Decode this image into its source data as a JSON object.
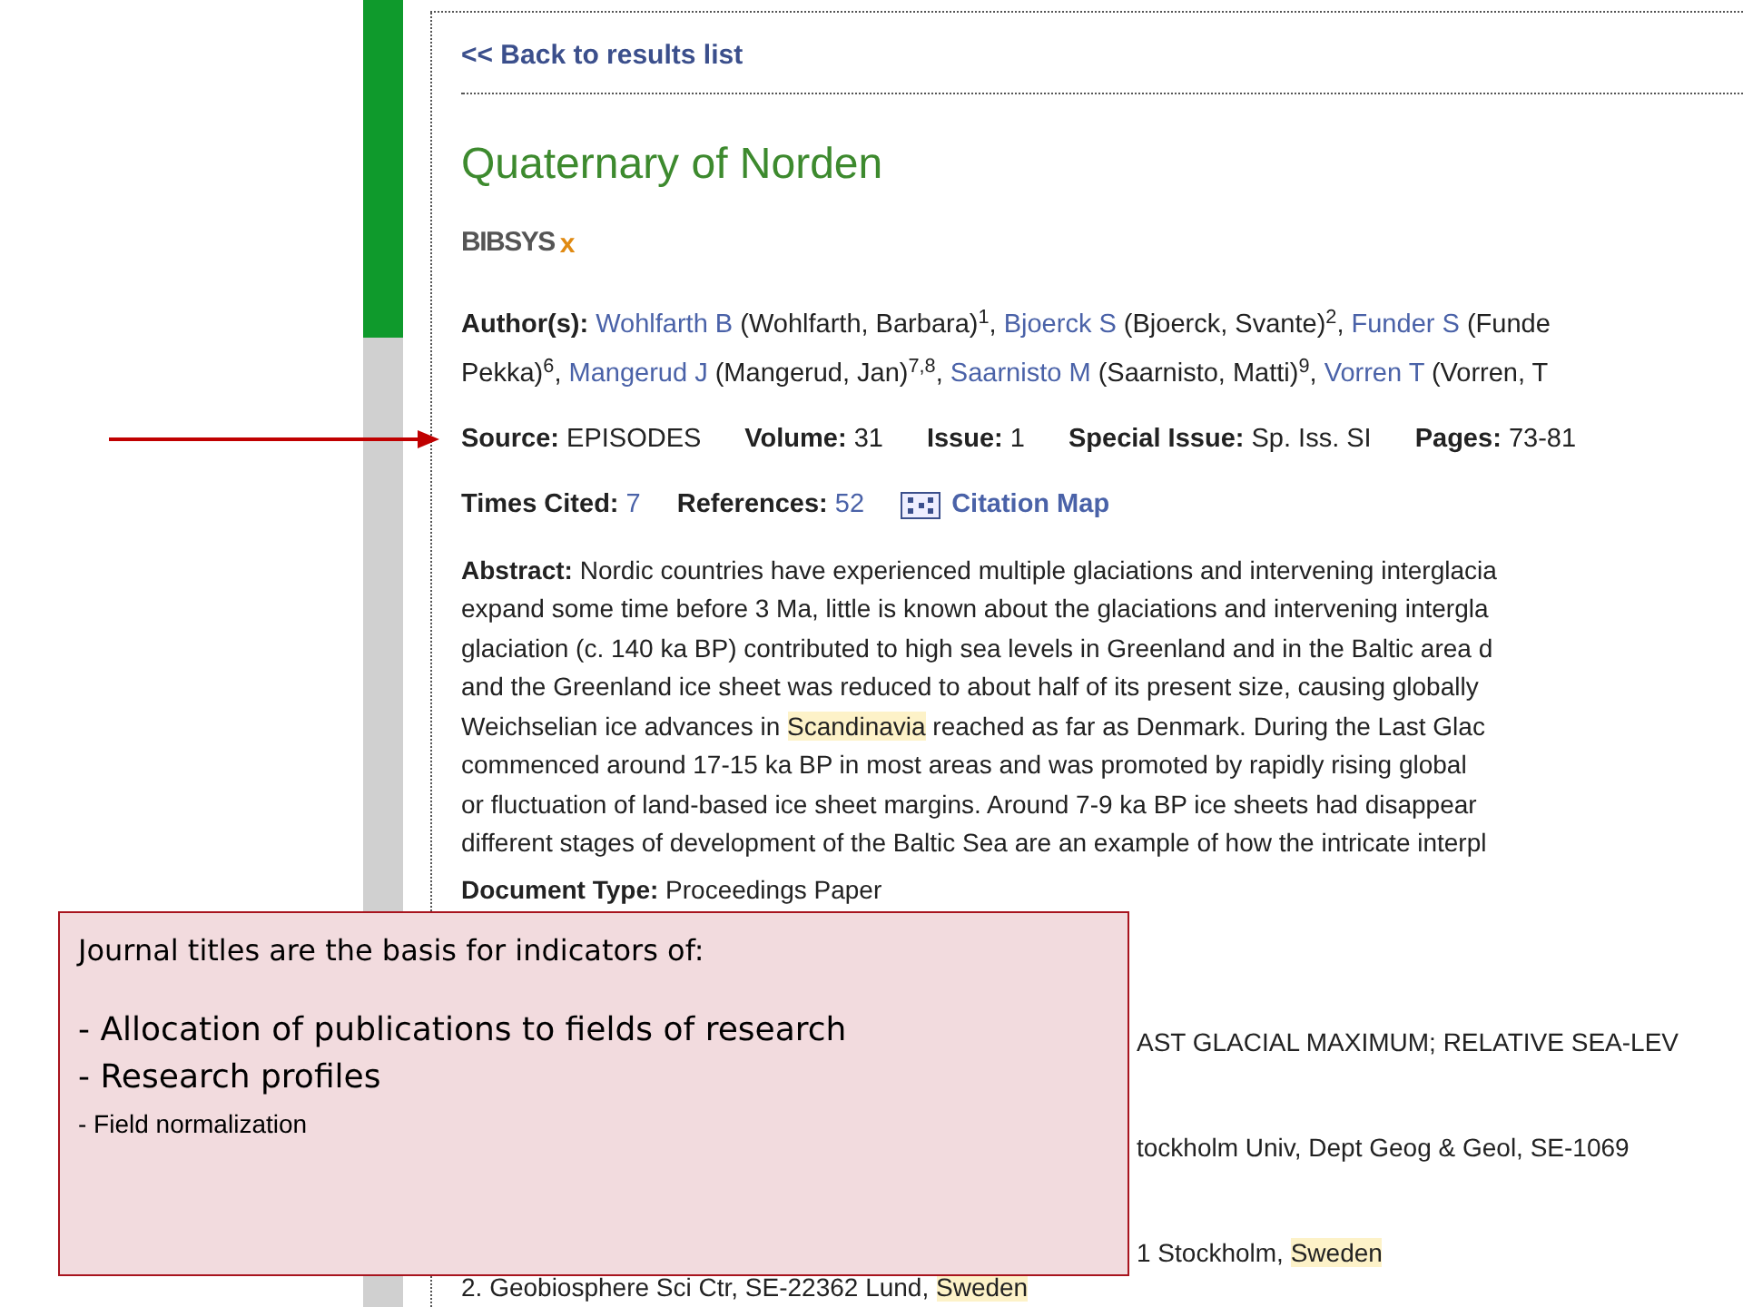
{
  "back_link": "<< Back to results list",
  "title": "Quaternary of Norden",
  "logo": {
    "text": "BIBSYS",
    "mark": "x"
  },
  "authors": {
    "label": "Author(s):",
    "lines": [
      [
        {
          "link": "Wohlfarth B",
          "rest": " (Wohlfarth, Barbara)$^{1}$, "
        },
        {
          "link": "Bjoerck S",
          "rest": " (Bjoerck, Svante)$^{2}$, "
        },
        {
          "link": "Funder S",
          "rest": " (Funde"
        }
      ],
      [
        {
          "rest": "Pekka)$^{6}$, "
        },
        {
          "link": "Mangerud J",
          "rest": " (Mangerud, Jan)$^{7,8}$, "
        },
        {
          "link": "Saarnisto M",
          "rest": " (Saarnisto, Matti)$^{9}$, "
        },
        {
          "link": "Vorren T",
          "rest": " (Vorren, T"
        }
      ]
    ]
  },
  "source_row": [
    {
      "label": "Source:",
      "value": "EPISODES",
      "link": false
    },
    {
      "label": "Volume:",
      "value": "31",
      "link": false
    },
    {
      "label": "Issue:",
      "value": "1",
      "link": false
    },
    {
      "label": "Special Issue:",
      "value": "Sp. Iss. SI",
      "link": false
    },
    {
      "label": "Pages:",
      "value": "73-81",
      "link": false
    }
  ],
  "citation_row": [
    {
      "label": "Times Cited:",
      "value": "7",
      "link": true
    },
    {
      "label": "References:",
      "value": "52",
      "link": true
    }
  ],
  "citation_map": "Citation Map",
  "abstract": {
    "label": "Abstract:",
    "lines": [
      [
        {
          "text": "Nordic countries have experienced multiple glaciations and intervening interglacia",
          "highlight": false
        }
      ],
      [
        {
          "text": "expand some time before 3 Ma, little is known about the glaciations and intervening intergla",
          "highlight": false
        }
      ],
      [
        {
          "text": "glaciation (c. 140 ka BP) contributed to high sea levels in Greenland and in the Baltic area d",
          "highlight": false
        }
      ],
      [
        {
          "text": "and the Greenland ice sheet was reduced to about half of its present size, causing globally",
          "highlight": false
        }
      ],
      [
        {
          "text": "Weichselian ice advances in ",
          "highlight": false
        },
        {
          "text": "Scandinavia",
          "highlight": true
        },
        {
          "text": " reached as far as Denmark. During the Last Glac",
          "highlight": false
        }
      ],
      [
        {
          "text": "commenced around 17-15 ka BP in most areas and was promoted by rapidly rising global",
          "highlight": false
        }
      ],
      [
        {
          "text": "or fluctuation of land-based ice sheet margins. Around 7-9 ka BP ice sheets had disappear",
          "highlight": false
        }
      ],
      [
        {
          "text": "different stages of development of the Baltic Sea are an example of how the intricate interpl",
          "highlight": false
        }
      ]
    ]
  },
  "document_type": {
    "label": "Document Type:",
    "value": "Proceedings Paper"
  },
  "partial_lines": [
    [
      {
        "text": "AST GLACIAL MAXIMUM; RELATIVE SEA-LEV",
        "highlight": false
      }
    ],
    [
      {
        "text": "tockholm Univ, Dept Geog & Geol, SE-1069",
        "highlight": false
      }
    ],
    [
      {
        "text": "1 Stockholm, ",
        "highlight": false
      },
      {
        "text": "Sweden",
        "highlight": true
      }
    ]
  ],
  "address_line": [
    {
      "text": "2. Geobiosphere Sci Ctr, SE-22362 Lund, ",
      "highlight": false
    },
    {
      "text": "Sweden",
      "highlight": true
    }
  ],
  "callout": {
    "heading": "Journal titles are the basis for indicators of:",
    "items": [
      {
        "text": "- Allocation of publications to fields of research",
        "kind": "large"
      },
      {
        "text": "- Research profiles",
        "kind": "large"
      },
      {
        "text": "- Field normalization",
        "kind": "small"
      }
    ]
  }
}
